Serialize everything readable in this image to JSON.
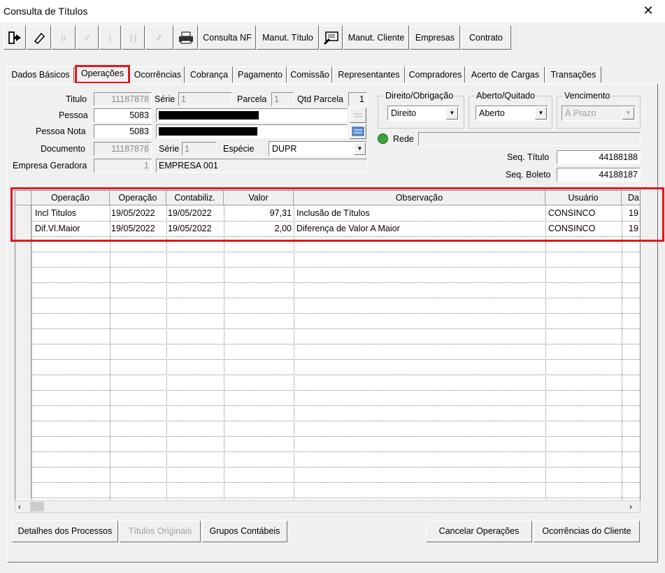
{
  "window": {
    "title": "Consulta de Títulos",
    "close_icon": "close-icon"
  },
  "toolbar": {
    "exit_icon": "exit-door-icon",
    "eraser_icon": "eraser-icon",
    "first_icon": "first-record-icon",
    "check_icon": "check-icon",
    "last_icon": "last-record-icon",
    "grid_icon": "columns-icon",
    "filter_icon": "filter-icon",
    "print_icon": "printer-icon",
    "consulta_nf": "Consulta NF",
    "manut_titulo": "Manut. Título",
    "monitor_icon": "monitor-edit-icon",
    "manut_cliente": "Manut. Cliente",
    "empresas": "Empresas",
    "contrato": "Contrato"
  },
  "tabs": [
    "Dados Básicos",
    "Operações",
    "Ocorrências",
    "Cobrança",
    "Pagamento",
    "Comissão",
    "Representantes",
    "Compradores",
    "Acerto de Cargas",
    "Transações"
  ],
  "active_tab": "Operações",
  "form": {
    "titulo_label": "Titulo",
    "titulo": "11187878",
    "serie_label": "Série",
    "serie": "1",
    "parcela_label": "Parcela",
    "parcela": "1",
    "qtd_parcela_label": "Qtd Parcela",
    "qtd_parcela": "1",
    "pessoa_label": "Pessoa",
    "pessoa": "5083",
    "pessoa_nota_label": "Pessoa Nota",
    "pessoa_nota": "5083",
    "documento_label": "Documento",
    "documento": "11187878",
    "serie2_label": "Série",
    "serie2": "1",
    "especie_label": "Espécie",
    "especie": "DUPR",
    "empresa_label": "Empresa Geradora",
    "empresa_num": "1",
    "empresa_nome": "EMPRESA 001",
    "direito_group": "Direito/Obrigação",
    "direito": "Direito",
    "aberto_group": "Aberto/Quitado",
    "aberto": "Aberto",
    "vencimento_group": "Vencimento",
    "vencimento": "À Prazo",
    "rede_label": "Rede",
    "seq_titulo_label": "Seq. Título",
    "seq_titulo": "44188188",
    "seq_boleto_label": "Seq. Boleto",
    "seq_boleto": "44188187"
  },
  "grid": {
    "headers": [
      "Operação",
      "Operação",
      "Contabiliz.",
      "Valor",
      "Observação",
      "Usuário",
      "Da"
    ],
    "rows": [
      [
        "Incl Titulos",
        "19/05/2022",
        "19/05/2022",
        "97,31",
        "Inclusão de Títulos",
        "CONSINCO",
        "19"
      ],
      [
        "Dif.Vl.Maior",
        "19/05/2022",
        "19/05/2022",
        "2,00",
        "Diferença de Valor A Maior",
        "CONSINCO",
        "19"
      ]
    ]
  },
  "buttons": {
    "detalhes": "Detalhes dos Processos",
    "titulos_originais": "Títulos Originais",
    "grupos": "Grupos Contábeis",
    "cancelar": "Cancelar Operações",
    "ocorrencias_cliente": "Ocorrências do Cliente"
  },
  "colors": {
    "highlight": "#e4171d",
    "rede_led": "#3aa53a"
  }
}
